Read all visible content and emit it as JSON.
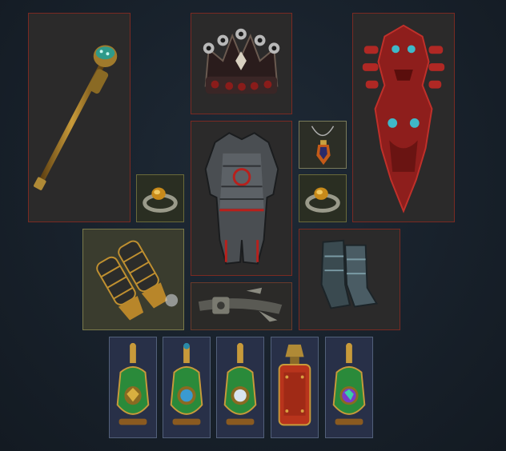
{
  "slots": [
    {
      "id": "weapon",
      "item": "sceptre-icon"
    },
    {
      "id": "helmet",
      "item": "crown-icon"
    },
    {
      "id": "offhand",
      "item": "totem-shield-icon"
    },
    {
      "id": "body-armour",
      "item": "plate-armour-icon"
    },
    {
      "id": "amulet",
      "item": "amulet-icon"
    },
    {
      "id": "ring-left",
      "item": "ring-icon"
    },
    {
      "id": "ring-right",
      "item": "ring-icon"
    },
    {
      "id": "gloves",
      "item": "gauntlets-icon"
    },
    {
      "id": "belt",
      "item": "belt-icon"
    },
    {
      "id": "boots",
      "item": "boots-icon"
    },
    {
      "id": "flask-1",
      "item": "green-flask-icon"
    },
    {
      "id": "flask-2",
      "item": "green-flask-icon"
    },
    {
      "id": "flask-3",
      "item": "green-flask-icon"
    },
    {
      "id": "flask-4",
      "item": "red-flask-icon"
    },
    {
      "id": "flask-5",
      "item": "green-flask-icon"
    }
  ],
  "colors": {
    "background": "#18212b",
    "slot_border_unique": "#7a2a22",
    "slot_border_flask": "#52607a",
    "slot_border_ring": "#6a6a3a"
  }
}
